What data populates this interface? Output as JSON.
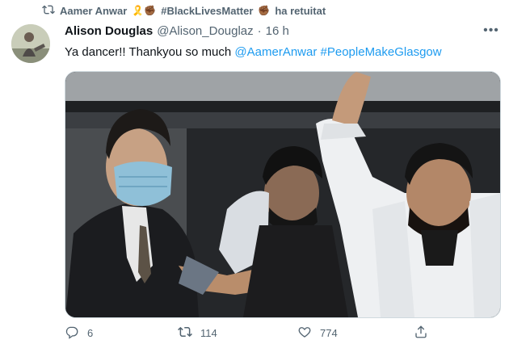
{
  "retweet": {
    "icon": "retweet-icon",
    "retweeter_name": "Aamer Anwar",
    "name_emojis": "🎗️✊🏾",
    "hashtag": "#BlackLivesMatter",
    "trailing_emoji": "✊🏾",
    "suffix": "ha retuitat"
  },
  "tweet": {
    "display_name": "Alison Douglas",
    "handle": "@Alison_Douglaz",
    "separator": "·",
    "time": "16 h",
    "text_plain": "Ya dancer!! Thankyou so much ",
    "mention": "@AamerAnwar",
    "hashtag": "#PeopleMakeGlasgow",
    "more_icon": "more-horizontal-icon",
    "more_glyph": "•••"
  },
  "actions": {
    "reply_count": "6",
    "retweet_count": "114",
    "like_count": "774"
  },
  "colors": {
    "link": "#1d9bf0",
    "secondary_text": "#536471",
    "primary_text": "#0f1419"
  }
}
